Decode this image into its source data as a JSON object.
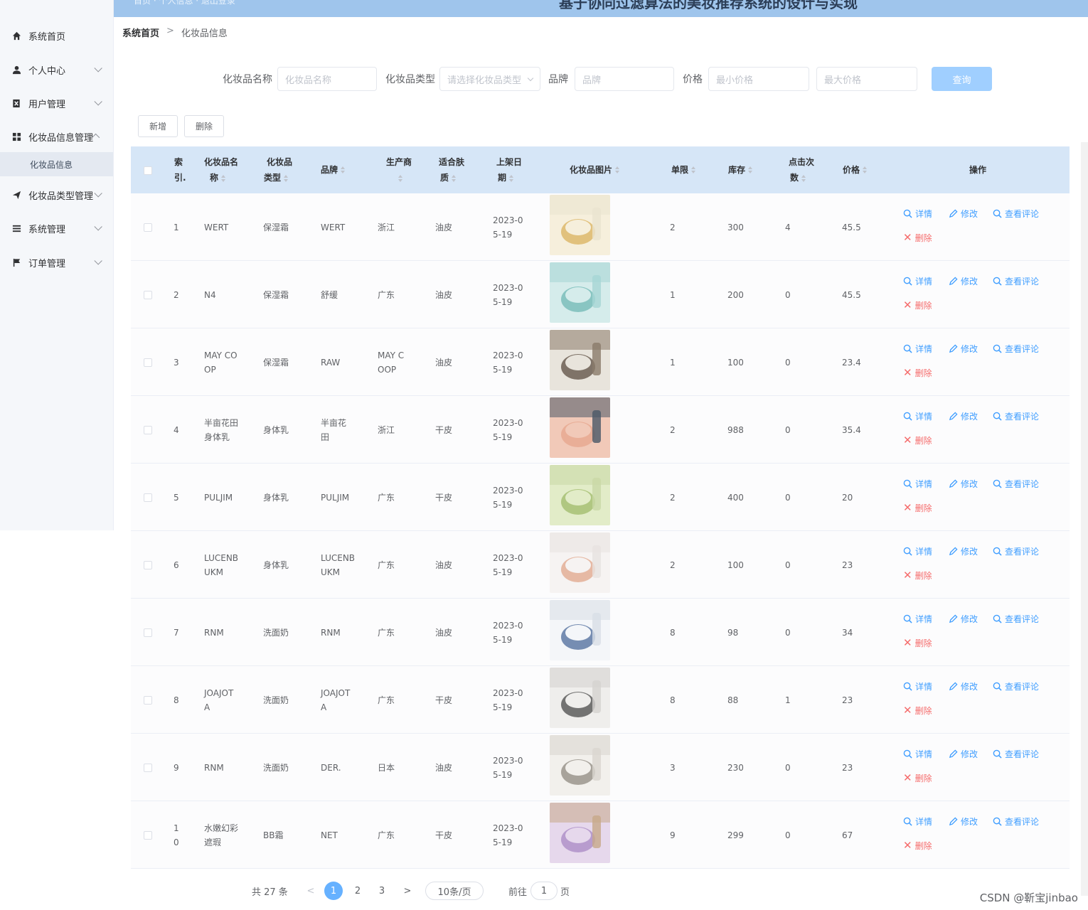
{
  "header": {
    "subtitle": "首页 · 个人信息 · 退出登录",
    "title": "基于协同过滤算法的美妆推荐系统的设计与实现"
  },
  "sidebar": {
    "items": [
      {
        "label": "系统首页",
        "icon": "home-icon"
      },
      {
        "label": "个人中心",
        "icon": "user-icon"
      },
      {
        "label": "用户管理",
        "icon": "user-manage-icon"
      },
      {
        "label": "化妆品信息管理",
        "icon": "grid-icon"
      },
      {
        "label": "化妆品类型管理",
        "icon": "send-icon"
      },
      {
        "label": "系统管理",
        "icon": "list-icon"
      },
      {
        "label": "订单管理",
        "icon": "flag-icon"
      }
    ],
    "active_sub": "化妆品信息"
  },
  "breadcrumb": {
    "home": "系统首页",
    "sep": ">",
    "current": "化妆品信息"
  },
  "search": {
    "name_label": "化妆品名称",
    "name_placeholder": "化妆品名称",
    "type_label": "化妆品类型",
    "type_placeholder": "请选择化妆品类型",
    "brand_label": "品牌",
    "brand_placeholder": "品牌",
    "price_label": "价格",
    "min_price_placeholder": "最小价格",
    "max_price_placeholder": "最大价格",
    "query_label": "查询"
  },
  "actions": {
    "add_label": "新增",
    "delete_label": "删除"
  },
  "table": {
    "headers": {
      "index": [
        "索",
        "引."
      ],
      "name": [
        "化妆品名",
        "称"
      ],
      "type": [
        "化妆品",
        "类型"
      ],
      "brand": "品牌",
      "maker": [
        "生产商",
        ""
      ],
      "skin": [
        "适合肤",
        "质"
      ],
      "date": [
        "上架日",
        "期"
      ],
      "image": "化妆品图片",
      "limit": "单限",
      "stock": "库存",
      "clicks": [
        "点击次",
        "数"
      ],
      "price": "价格",
      "ops": "操作"
    },
    "ops": {
      "detail": "详情",
      "edit": "修改",
      "comments": "查看评论",
      "delete": "删除"
    },
    "rows": [
      {
        "idx": [
          "1"
        ],
        "name": [
          "WERT"
        ],
        "type": "保湿霜",
        "brand": [
          "WERT"
        ],
        "maker": [
          "浙江"
        ],
        "skin": "油皮",
        "date": [
          "2023-0",
          "5-19"
        ],
        "limit": "2",
        "stock": "300",
        "clicks": "4",
        "price": "45.5",
        "img": [
          "#eae3d0",
          "#f6efdc",
          "#d9b25e"
        ]
      },
      {
        "idx": [
          "2"
        ],
        "name": [
          "N4"
        ],
        "type": "保湿霜",
        "brand": [
          "舒缓"
        ],
        "maker": [
          "广东"
        ],
        "skin": "油皮",
        "date": [
          "2023-0",
          "5-19"
        ],
        "limit": "1",
        "stock": "200",
        "clicks": "0",
        "price": "45.5",
        "img": [
          "#a6d6d4",
          "#d5eceb",
          "#6fb8b4"
        ]
      },
      {
        "idx": [
          "3"
        ],
        "name": [
          "MAY CO",
          "OP"
        ],
        "type": "保湿霜",
        "brand": [
          "RAW"
        ],
        "maker": [
          "MAY C",
          "OOP"
        ],
        "skin": "油皮",
        "date": [
          "2023-0",
          "5-19"
        ],
        "limit": "1",
        "stock": "100",
        "clicks": "0",
        "price": "23.4",
        "img": [
          "#8a7a6a",
          "#e8e4dc",
          "#5c4e42"
        ]
      },
      {
        "idx": [
          "4"
        ],
        "name": [
          "半亩花田",
          "身体乳"
        ],
        "type": "身体乳",
        "brand": [
          "半亩花",
          "田"
        ],
        "maker": [
          "浙江"
        ],
        "skin": "干皮",
        "date": [
          "2023-0",
          "5-19"
        ],
        "limit": "2",
        "stock": "988",
        "clicks": "0",
        "price": "35.4",
        "img": [
          "#4a5866",
          "#f1c9b8",
          "#e6a48c"
        ]
      },
      {
        "idx": [
          "5"
        ],
        "name": [
          "PULJIM"
        ],
        "type": "身体乳",
        "brand": [
          "PULJIM"
        ],
        "maker": [
          "广东"
        ],
        "skin": "干皮",
        "date": [
          "2023-0",
          "5-19"
        ],
        "limit": "2",
        "stock": "400",
        "clicks": "0",
        "price": "20",
        "img": [
          "#c9d8a6",
          "#e2ecc8",
          "#9fbb6a"
        ]
      },
      {
        "idx": [
          "6"
        ],
        "name": [
          "LUCENB",
          "UKM"
        ],
        "type": "身体乳",
        "brand": [
          "LUCENB",
          "UKM"
        ],
        "maker": [
          "广东"
        ],
        "skin": "油皮",
        "date": [
          "2023-0",
          "5-19"
        ],
        "limit": "2",
        "stock": "100",
        "clicks": "0",
        "price": "23",
        "img": [
          "#e7e2e0",
          "#f6f3f2",
          "#e0a68a"
        ]
      },
      {
        "idx": [
          "7"
        ],
        "name": [
          "RNM"
        ],
        "type": "洗面奶",
        "brand": [
          "RNM"
        ],
        "maker": [
          "广东"
        ],
        "skin": "油皮",
        "date": [
          "2023-0",
          "5-19"
        ],
        "limit": "8",
        "stock": "98",
        "clicks": "0",
        "price": "34",
        "img": [
          "#d8dee6",
          "#f4f6f9",
          "#4c6a9a"
        ]
      },
      {
        "idx": [
          "8"
        ],
        "name": [
          "JOAJOT",
          "A"
        ],
        "type": "洗面奶",
        "brand": [
          "JOAJOT",
          "A"
        ],
        "maker": [
          "广东"
        ],
        "skin": "干皮",
        "date": [
          "2023-0",
          "5-19"
        ],
        "limit": "8",
        "stock": "88",
        "clicks": "1",
        "price": "23",
        "img": [
          "#d4d2cf",
          "#efeeec",
          "#4a4a4a"
        ]
      },
      {
        "idx": [
          "9"
        ],
        "name": [
          "RNM"
        ],
        "type": "洗面奶",
        "brand": [
          "DER."
        ],
        "maker": [
          "日本"
        ],
        "skin": "油皮",
        "date": [
          "2023-0",
          "5-19"
        ],
        "limit": "3",
        "stock": "230",
        "clicks": "0",
        "price": "23",
        "img": [
          "#d9d6d0",
          "#f2f0ec",
          "#8f8a80"
        ]
      },
      {
        "idx": [
          "1",
          "0"
        ],
        "name": [
          "水嫩幻彩",
          "遮瑕"
        ],
        "type": "BB霜",
        "brand": [
          "NET"
        ],
        "maker": [
          "广东"
        ],
        "skin": "干皮",
        "date": [
          "2023-0",
          "5-19"
        ],
        "limit": "9",
        "stock": "299",
        "clicks": "0",
        "price": "67",
        "img": [
          "#c7a98a",
          "#e6d8ec",
          "#a888c4"
        ]
      }
    ]
  },
  "pager": {
    "total": "共 27 条",
    "prev": "<",
    "pages": [
      "1",
      "2",
      "3"
    ],
    "next": ">",
    "page_size": "10条/页",
    "goto_label": "前往",
    "goto_value": "1",
    "goto_suffix": "页"
  },
  "watermark": "CSDN @靳宝jinbao",
  "colors": {
    "accent": "#409eff",
    "danger": "#f56c6c",
    "header_bg": "#d6e6f7",
    "topbar": "#9fc5ec"
  }
}
